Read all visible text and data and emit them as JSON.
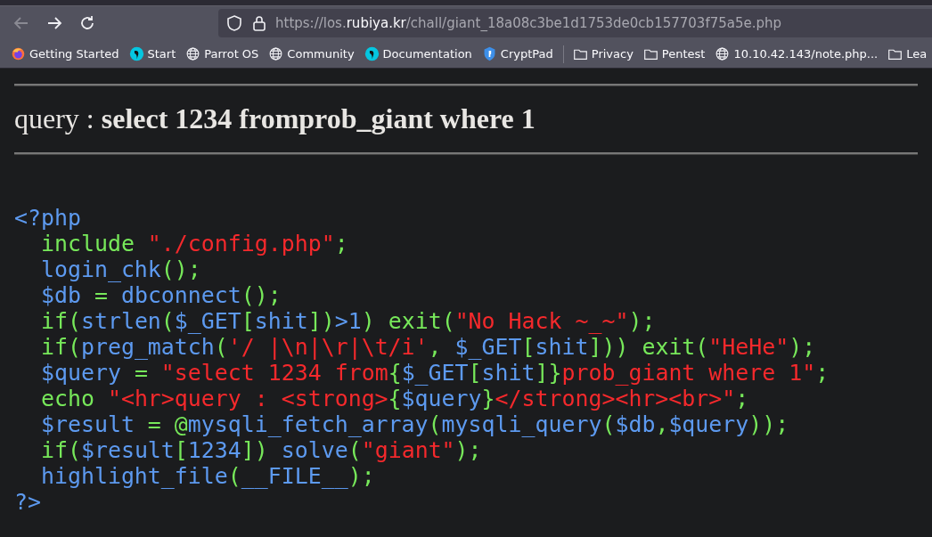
{
  "browser": {
    "url": {
      "prefix": "https://los.",
      "domain": "rubiya.kr",
      "suffix": "/chall/giant_18a08c3be1d1753de0cb157703f75a5e.php"
    },
    "bookmarks": [
      {
        "kind": "firefox",
        "label": "Getting Started"
      },
      {
        "kind": "parrot",
        "label": "Start"
      },
      {
        "kind": "globe",
        "label": "Parrot OS"
      },
      {
        "kind": "globe",
        "label": "Community"
      },
      {
        "kind": "parrot",
        "label": "Documentation"
      },
      {
        "kind": "shield",
        "label": "CryptPad"
      },
      {
        "kind": "separator"
      },
      {
        "kind": "folder",
        "label": "Privacy"
      },
      {
        "kind": "folder",
        "label": "Pentest"
      },
      {
        "kind": "globe",
        "label": "10.10.42.143/note.php..."
      },
      {
        "kind": "folder",
        "label": "Lea"
      }
    ]
  },
  "page": {
    "heading": "query : **select 1234 fromprob_giant where 1**",
    "code": [
      [
        {
          "kind": "default",
          "text": "<?php"
        }
      ],
      [
        {
          "kind": "keyword",
          "text": "  include "
        },
        {
          "kind": "string",
          "text": "\"./config.php\""
        },
        {
          "kind": "keyword",
          "text": ";"
        }
      ],
      [
        {
          "kind": "default",
          "text": "  login_chk"
        },
        {
          "kind": "keyword",
          "text": "();"
        }
      ],
      [
        {
          "kind": "default",
          "text": "  $db "
        },
        {
          "kind": "keyword",
          "text": "= "
        },
        {
          "kind": "default",
          "text": "dbconnect"
        },
        {
          "kind": "keyword",
          "text": "();"
        }
      ],
      [
        {
          "kind": "keyword",
          "text": "  if("
        },
        {
          "kind": "default",
          "text": "strlen"
        },
        {
          "kind": "keyword",
          "text": "("
        },
        {
          "kind": "default",
          "text": "$_GET"
        },
        {
          "kind": "keyword",
          "text": "["
        },
        {
          "kind": "default",
          "text": "shit"
        },
        {
          "kind": "keyword",
          "text": "])"
        },
        {
          "kind": "default",
          "text": ">1"
        },
        {
          "kind": "keyword",
          "text": ") exit("
        },
        {
          "kind": "string",
          "text": "\"No Hack ~_~\""
        },
        {
          "kind": "keyword",
          "text": ");"
        }
      ],
      [
        {
          "kind": "keyword",
          "text": "  if("
        },
        {
          "kind": "default",
          "text": "preg_match"
        },
        {
          "kind": "keyword",
          "text": "("
        },
        {
          "kind": "string",
          "text": "'/ |\\n|\\r|\\t/i'"
        },
        {
          "kind": "keyword",
          "text": ", "
        },
        {
          "kind": "default",
          "text": "$_GET"
        },
        {
          "kind": "keyword",
          "text": "["
        },
        {
          "kind": "default",
          "text": "shit"
        },
        {
          "kind": "keyword",
          "text": "])) exit("
        },
        {
          "kind": "string",
          "text": "\"HeHe\""
        },
        {
          "kind": "keyword",
          "text": ");"
        }
      ],
      [
        {
          "kind": "default",
          "text": "  $query "
        },
        {
          "kind": "keyword",
          "text": "= "
        },
        {
          "kind": "string",
          "text": "\"select 1234 from"
        },
        {
          "kind": "keyword",
          "text": "{"
        },
        {
          "kind": "default",
          "text": "$_GET"
        },
        {
          "kind": "keyword",
          "text": "["
        },
        {
          "kind": "default",
          "text": "shit"
        },
        {
          "kind": "keyword",
          "text": "]}"
        },
        {
          "kind": "string",
          "text": "prob_giant where 1\""
        },
        {
          "kind": "keyword",
          "text": ";"
        }
      ],
      [
        {
          "kind": "keyword",
          "text": "  echo "
        },
        {
          "kind": "string",
          "text": "\"<hr>query : <strong>"
        },
        {
          "kind": "keyword",
          "text": "{"
        },
        {
          "kind": "default",
          "text": "$query"
        },
        {
          "kind": "keyword",
          "text": "}"
        },
        {
          "kind": "string",
          "text": "</strong><hr><br>\""
        },
        {
          "kind": "keyword",
          "text": ";"
        }
      ],
      [
        {
          "kind": "default",
          "text": "  $result "
        },
        {
          "kind": "keyword",
          "text": "= @"
        },
        {
          "kind": "default",
          "text": "mysqli_fetch_array"
        },
        {
          "kind": "keyword",
          "text": "("
        },
        {
          "kind": "default",
          "text": "mysqli_query"
        },
        {
          "kind": "keyword",
          "text": "("
        },
        {
          "kind": "default",
          "text": "$db"
        },
        {
          "kind": "keyword",
          "text": ","
        },
        {
          "kind": "default",
          "text": "$query"
        },
        {
          "kind": "keyword",
          "text": "));"
        }
      ],
      [
        {
          "kind": "keyword",
          "text": "  if("
        },
        {
          "kind": "default",
          "text": "$result"
        },
        {
          "kind": "keyword",
          "text": "["
        },
        {
          "kind": "default",
          "text": "1234"
        },
        {
          "kind": "keyword",
          "text": "]) "
        },
        {
          "kind": "default",
          "text": "solve"
        },
        {
          "kind": "keyword",
          "text": "("
        },
        {
          "kind": "string",
          "text": "\"giant\""
        },
        {
          "kind": "keyword",
          "text": ");"
        }
      ],
      [
        {
          "kind": "default",
          "text": "  highlight_file"
        },
        {
          "kind": "keyword",
          "text": "("
        },
        {
          "kind": "default",
          "text": "__FILE__"
        },
        {
          "kind": "keyword",
          "text": ");"
        }
      ],
      [
        {
          "kind": "default",
          "text": "?>"
        }
      ]
    ]
  }
}
